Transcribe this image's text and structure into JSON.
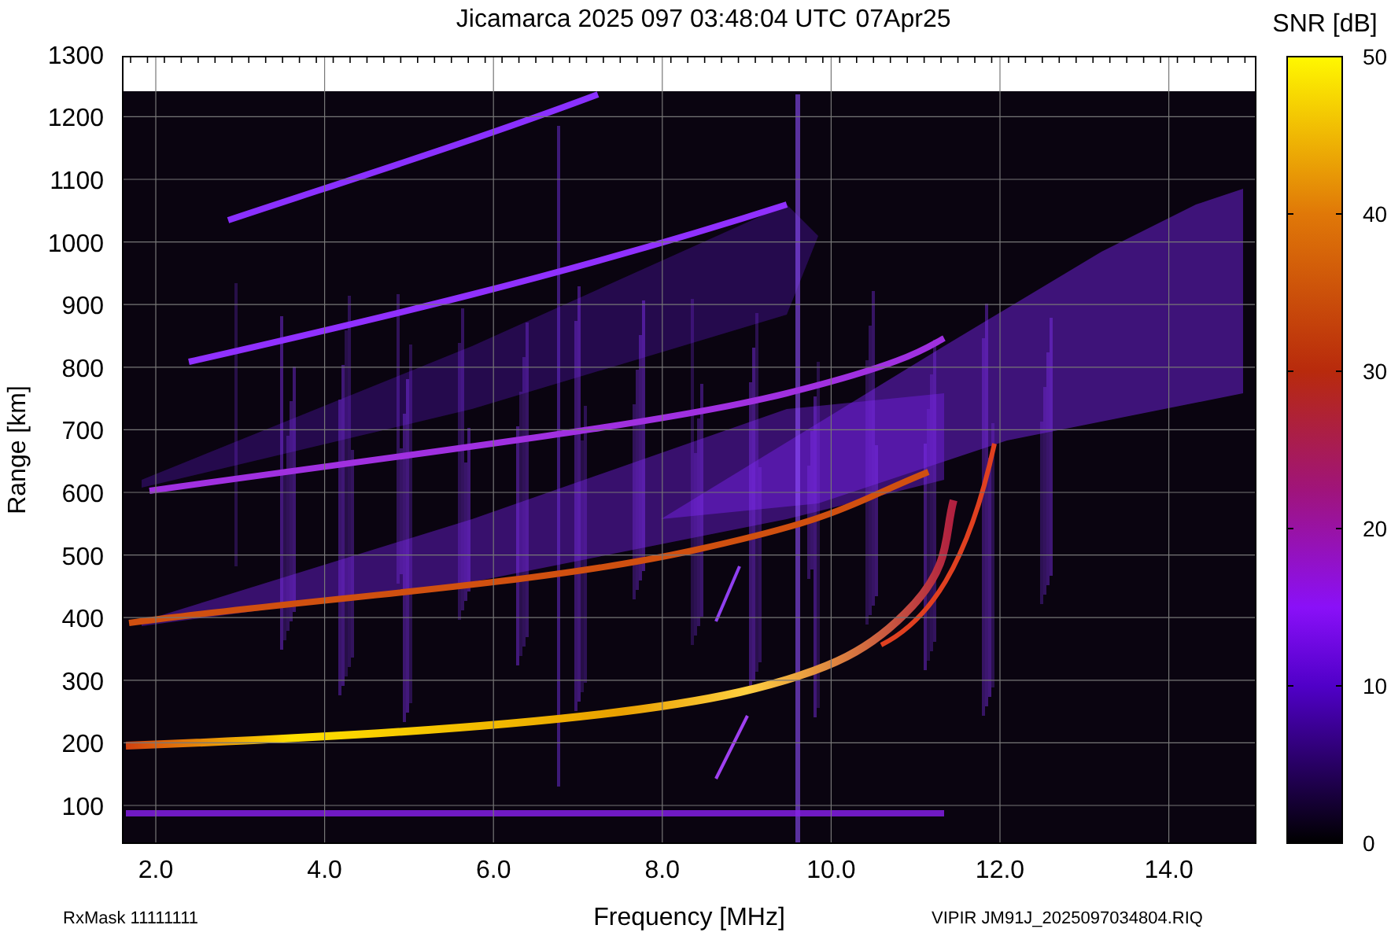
{
  "title": "Jicamarca 2025 097 03:48:04 UTC",
  "date": "07Apr25",
  "colorbar": {
    "title": "SNR [dB]",
    "ticks": [
      "50",
      "40",
      "30",
      "20",
      "10",
      "0"
    ]
  },
  "y_axis": {
    "label": "Range [km]",
    "ticks": [
      "1300",
      "1200",
      "1100",
      "1000",
      "900",
      "800",
      "700",
      "600",
      "500",
      "400",
      "300",
      "200",
      "100"
    ]
  },
  "x_axis": {
    "label": "Frequency [MHz]",
    "ticks": [
      "2.0",
      "4.0",
      "6.0",
      "8.0",
      "10.0",
      "12.0",
      "14.0"
    ]
  },
  "footer": {
    "left": "RxMask 11111111",
    "right": "VIPIR  JM91J_2025097034804.RIQ"
  }
}
